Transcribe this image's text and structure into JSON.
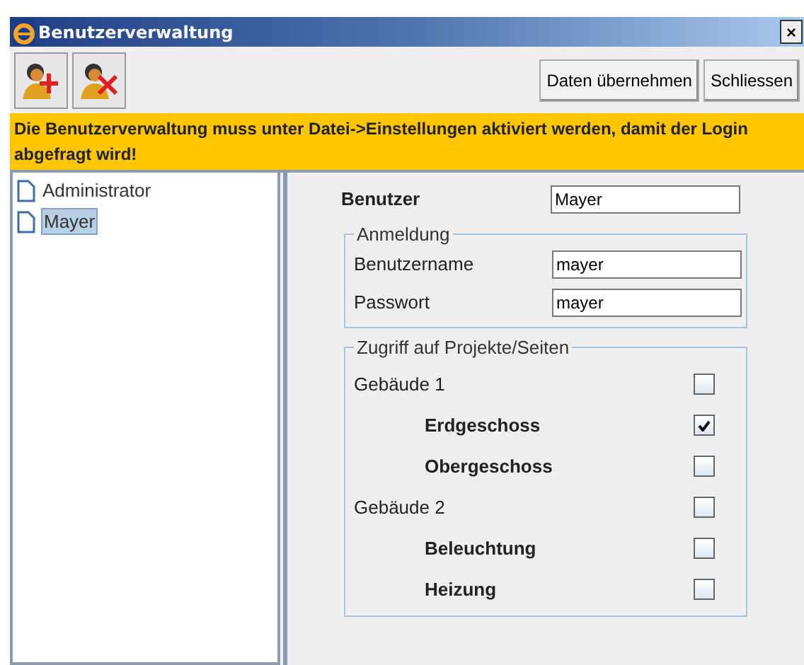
{
  "window": {
    "title": "Benutzerverwaltung",
    "close": "×"
  },
  "toolbar": {
    "buttons": [
      "Daten übernehmen",
      "Schliessen"
    ]
  },
  "banner": "Die Benutzerverwaltung muss unter Datei->Einstellungen aktiviert werden, damit der Login abgefragt wird!",
  "users": [
    {
      "name": "Administrator",
      "selected": false
    },
    {
      "name": "Mayer",
      "selected": true
    }
  ],
  "user": {
    "label": "Benutzer",
    "value": "Mayer"
  },
  "login": {
    "title": "Anmeldung",
    "username_label": "Benutzername",
    "username": "mayer",
    "password_label": "Passwort",
    "password": "mayer"
  },
  "access": {
    "title": "Zugriff auf Projekte/Seiten",
    "items": [
      {
        "label": "Gebäude 1",
        "checked": false,
        "children": [
          {
            "label": "Erdgeschoss",
            "checked": true
          },
          {
            "label": "Obergeschoss",
            "checked": false
          }
        ]
      },
      {
        "label": "Gebäude 2",
        "checked": false,
        "children": [
          {
            "label": "Beleuchtung",
            "checked": false
          },
          {
            "label": "Heizung",
            "checked": false
          }
        ]
      }
    ]
  }
}
